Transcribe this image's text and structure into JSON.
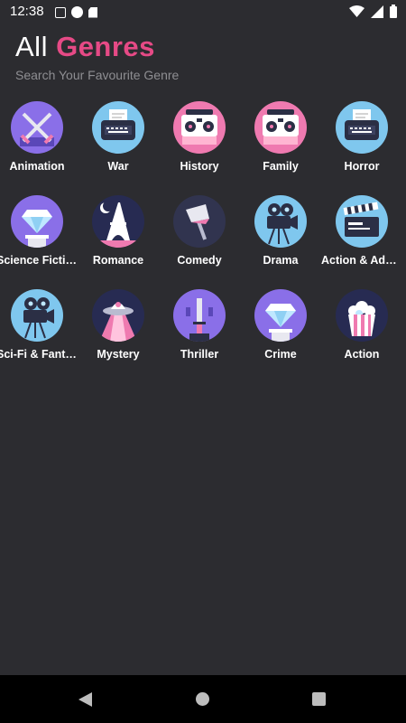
{
  "status": {
    "time": "12:38"
  },
  "header": {
    "title_part1": "All ",
    "title_part2": "Genres",
    "subtitle": "Search Your Favourite Genre"
  },
  "genres": [
    {
      "label": "Animation",
      "icon": "crossed-swords-icon",
      "bg": "#8a6fe8"
    },
    {
      "label": "War",
      "icon": "typewriter-icon",
      "bg": "#7fc7ee"
    },
    {
      "label": "History",
      "icon": "boombox-icon",
      "bg": "#ef7ab0"
    },
    {
      "label": "Family",
      "icon": "boombox-icon",
      "bg": "#ef7ab0"
    },
    {
      "label": "Horror",
      "icon": "typewriter-icon",
      "bg": "#7fc7ee"
    },
    {
      "label": "Science Fiction",
      "icon": "diamond-pedestal-icon",
      "bg": "#8a6fe8"
    },
    {
      "label": "Romance",
      "icon": "eiffel-tower-icon",
      "bg": "#272b52"
    },
    {
      "label": "Comedy",
      "icon": "axe-icon",
      "bg": "#31344f"
    },
    {
      "label": "Drama",
      "icon": "film-camera-icon",
      "bg": "#7fc7ee"
    },
    {
      "label": "Action & Adventure",
      "icon": "clapperboard-icon",
      "bg": "#7fc7ee"
    },
    {
      "label": "Sci-Fi & Fantasy",
      "icon": "film-camera-icon",
      "bg": "#7fc7ee"
    },
    {
      "label": "Mystery",
      "icon": "ufo-icon",
      "bg": "#272b52"
    },
    {
      "label": "Thriller",
      "icon": "knife-icon",
      "bg": "#8a6fe8"
    },
    {
      "label": "Crime",
      "icon": "diamond-pedestal-icon",
      "bg": "#8a6fe8"
    },
    {
      "label": "Action",
      "icon": "popcorn-icon",
      "bg": "#272b52"
    }
  ],
  "colors": {
    "background": "#2c2c30",
    "accent": "#e64a86",
    "subtitle": "#8e8e92"
  },
  "navigation": {
    "back": "back-icon",
    "home": "home-icon",
    "recents": "recents-icon"
  }
}
